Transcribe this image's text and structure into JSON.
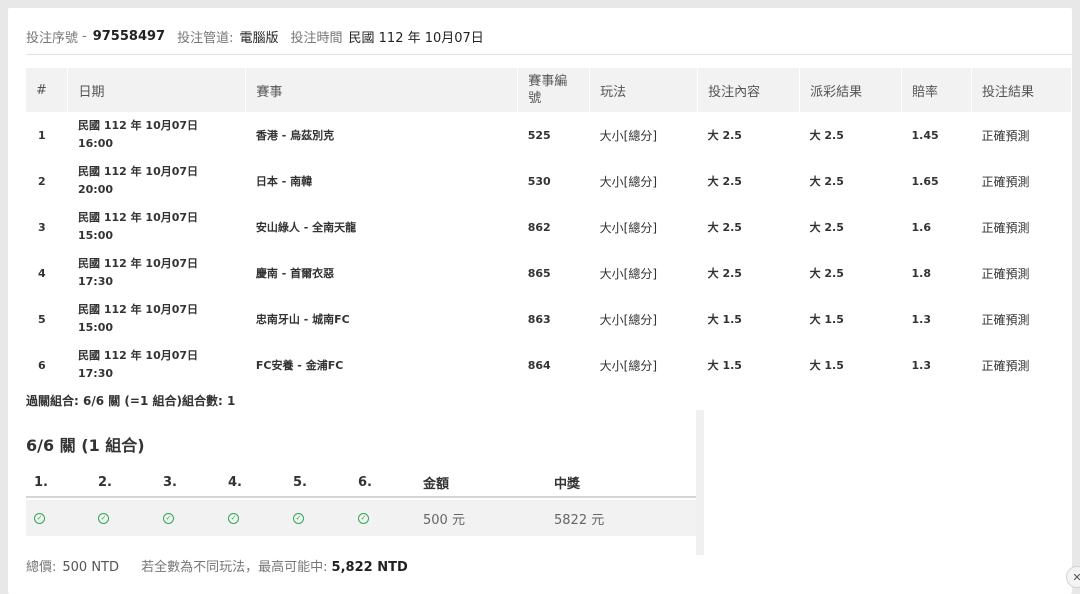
{
  "info": {
    "serial_label": "投注序號",
    "serial_sep": "-",
    "serial_value": "97558497",
    "channel_label": "投注管道:",
    "channel_value": "電腦版",
    "time_label": "投注時間",
    "time_value": "民國 112 年 10月07日"
  },
  "table": {
    "headers": [
      "#",
      "日期",
      "賽事",
      "賽事編號",
      "玩法",
      "投注內容",
      "派彩結果",
      "賠率",
      "投注結果"
    ],
    "rows": [
      {
        "no": "1",
        "date": "民國 112 年 10月07日",
        "time": "16:00",
        "match": "香港 - 烏茲別克",
        "code": "525",
        "play": "大小[總分]",
        "bet": "大 2.5",
        "payout": "大 2.5",
        "odds": "1.45",
        "result": "正確預測"
      },
      {
        "no": "2",
        "date": "民國 112 年 10月07日",
        "time": "20:00",
        "match": "日本 - 南韓",
        "code": "530",
        "play": "大小[總分]",
        "bet": "大 2.5",
        "payout": "大 2.5",
        "odds": "1.65",
        "result": "正確預測"
      },
      {
        "no": "3",
        "date": "民國 112 年 10月07日",
        "time": "15:00",
        "match": "安山綠人 - 全南天龍",
        "code": "862",
        "play": "大小[總分]",
        "bet": "大 2.5",
        "payout": "大 2.5",
        "odds": "1.6",
        "result": "正確預測"
      },
      {
        "no": "4",
        "date": "民國 112 年 10月07日",
        "time": "17:30",
        "match": "慶南 - 首爾衣惡",
        "code": "865",
        "play": "大小[總分]",
        "bet": "大 2.5",
        "payout": "大 2.5",
        "odds": "1.8",
        "result": "正確預測"
      },
      {
        "no": "5",
        "date": "民國 112 年 10月07日",
        "time": "15:00",
        "match": "忠南牙山 - 城南FC",
        "code": "863",
        "play": "大小[總分]",
        "bet": "大 1.5",
        "payout": "大 1.5",
        "odds": "1.3",
        "result": "正確預測"
      },
      {
        "no": "6",
        "date": "民國 112 年 10月07日",
        "time": "17:30",
        "match": "FC安養 - 金浦FC",
        "code": "864",
        "play": "大小[總分]",
        "bet": "大 1.5",
        "payout": "大 1.5",
        "odds": "1.3",
        "result": "正確預測"
      }
    ]
  },
  "combo_summary": {
    "label": "過關組合: 6/6 關 (=1 組合)組合數: 1"
  },
  "combo": {
    "title": "6/6 關 (1 組合)",
    "headers": [
      "1.",
      "2.",
      "3.",
      "4.",
      "5.",
      "6.",
      "金額",
      "中獎"
    ],
    "amount": "500 元",
    "prize": "5822 元"
  },
  "footer": {
    "total_label": "總價:",
    "total_value": "500 NTD",
    "max_label": "若全數為不同玩法，最高可能中:",
    "max_value": "5,822 NTD"
  },
  "icons": {
    "check_color": "#2eaa55",
    "close_icon": "close-icon"
  }
}
